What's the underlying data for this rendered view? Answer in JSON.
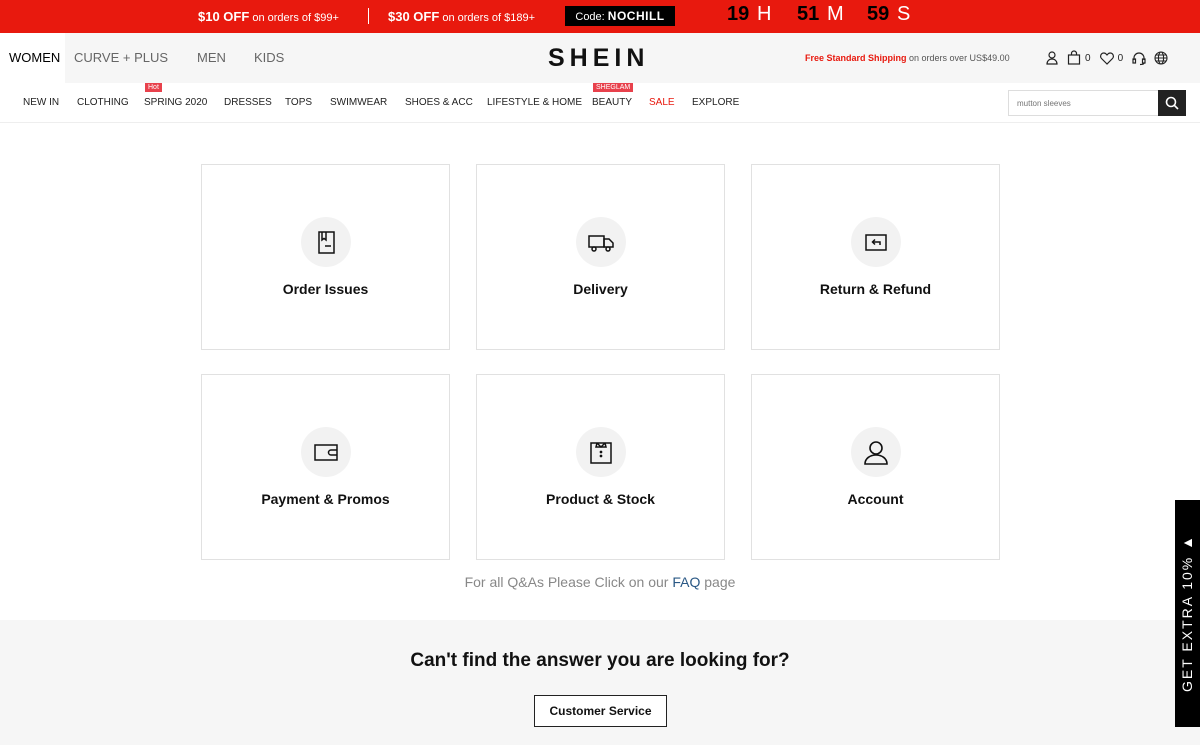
{
  "promo": {
    "offer1_amount": "$10 OFF",
    "offer1_text": "on orders of $99+",
    "offer2_amount": "$30 OFF",
    "offer2_text": "on orders of $189+",
    "code_label": "Code:",
    "code_value": "NOCHILL",
    "timer": {
      "hours": "19",
      "h_unit": "H",
      "minutes": "51",
      "m_unit": "M",
      "seconds": "59",
      "s_unit": "S"
    }
  },
  "header": {
    "tabs": [
      "WOMEN",
      "CURVE + PLUS",
      "MEN",
      "KIDS"
    ],
    "logo": "SHEIN",
    "shipping_highlight": "Free Standard Shipping",
    "shipping_text": "on orders over US$49.00",
    "cart_count": "0",
    "wishlist_count": "0"
  },
  "nav": {
    "items": [
      "NEW IN",
      "CLOTHING",
      "SPRING 2020",
      "DRESSES",
      "TOPS",
      "SWIMWEAR",
      "SHOES & ACC",
      "LIFESTYLE & HOME",
      "BEAUTY",
      "SALE",
      "EXPLORE"
    ],
    "tag_hot": "Hot",
    "tag_sheglam": "SHEGLAM"
  },
  "search": {
    "placeholder": "mutton sleeves"
  },
  "cards": [
    "Order Issues",
    "Delivery",
    "Return & Refund",
    "Payment & Promos",
    "Product & Stock",
    "Account"
  ],
  "faq": {
    "prefix": "For all Q&As Please Click on our",
    "link": "FAQ",
    "suffix": "page"
  },
  "bottom": {
    "question": "Can't find the answer you are looking for?",
    "button": "Customer Service"
  },
  "side_tab": {
    "label": "GET EXTRA 10% ▲"
  },
  "colors": {
    "brand_red": "#e8190e",
    "dark": "#222222",
    "link_blue": "#2a5885"
  },
  "icons": [
    "user-icon",
    "bag-icon",
    "heart-icon",
    "headset-icon",
    "globe-icon",
    "search-icon",
    "order-icon",
    "truck-icon",
    "return-icon",
    "wallet-icon",
    "shirt-icon",
    "account-icon"
  ]
}
